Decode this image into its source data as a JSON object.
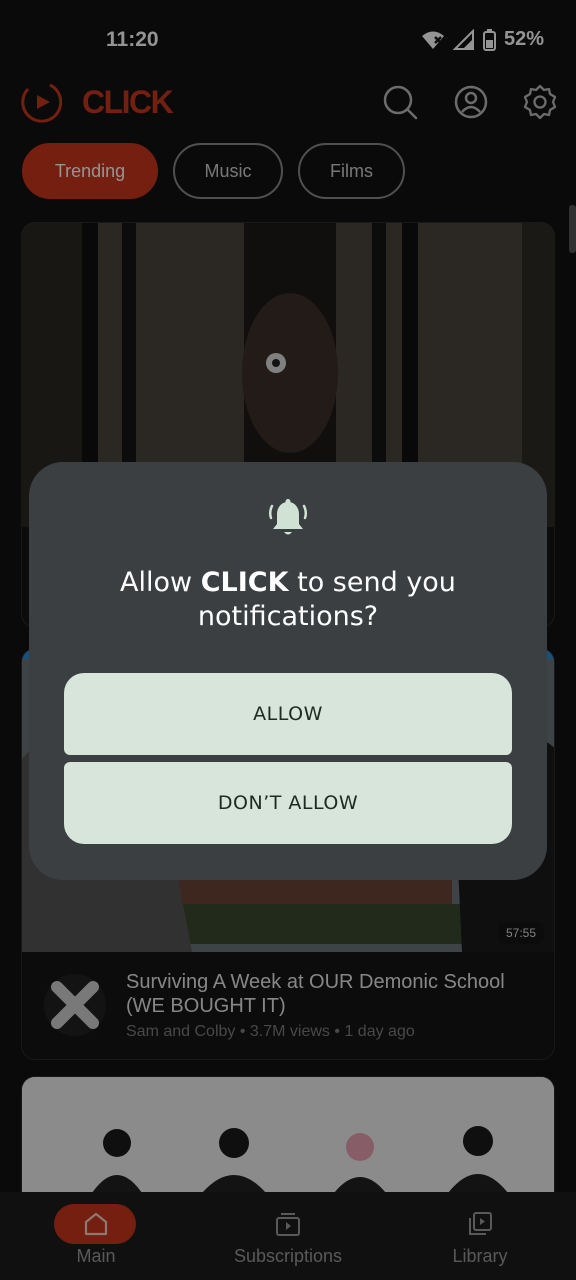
{
  "status_bar": {
    "time": "11:20",
    "battery": "52%"
  },
  "app": {
    "name": "CLICK",
    "brand_color": "#c8361a"
  },
  "chips": [
    {
      "label": "Trending",
      "active": true
    },
    {
      "label": "Music",
      "active": false
    },
    {
      "label": "Films",
      "active": false
    }
  ],
  "feed": {
    "videos": [
      {
        "duration": "57:55",
        "title": "Surviving A Week at OUR Demonic School (WE BOUGHT IT)",
        "channel": "Sam and Colby",
        "views": "3.7M views",
        "age": "1 day ago",
        "separator": "•"
      }
    ]
  },
  "bottom_nav": [
    {
      "label": "Main",
      "icon": "home-icon",
      "active": true
    },
    {
      "label": "Subscriptions",
      "icon": "subscriptions-icon",
      "active": false
    },
    {
      "label": "Library",
      "icon": "library-icon",
      "active": false
    }
  ],
  "permission_dialog": {
    "title_prefix": "Allow ",
    "app_name": "CLICK",
    "title_suffix": " to send you notifications?",
    "allow_label": "ALLOW",
    "deny_label": "DON’T ALLOW"
  }
}
